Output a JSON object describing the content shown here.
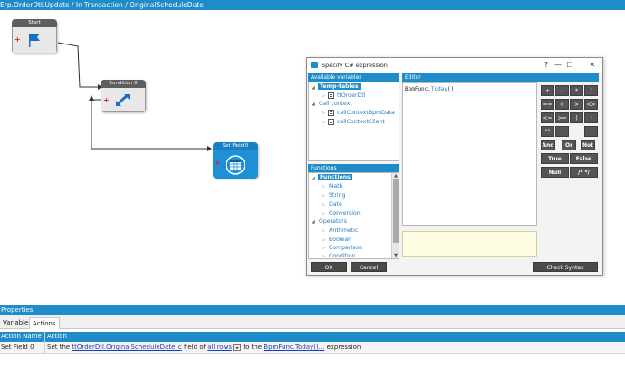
{
  "window": {
    "breadcrumb": "Erp.OrderDtl.Update / In-Transaction / OriginalScheduleDate"
  },
  "workflow": {
    "start_node": {
      "title": "Start"
    },
    "condition_node": {
      "title": "Condition 0"
    },
    "setfield_node": {
      "title": "Set Field 0"
    }
  },
  "dialog": {
    "title": "Specify C# expression",
    "window_controls": {
      "help": "?",
      "minimize": "—",
      "maximize": "☐",
      "close": "✕"
    },
    "variables_header": "Available variables",
    "variables_tree": [
      {
        "label": "Temp-tables",
        "selected": true
      },
      {
        "label": "ttOrderDtl"
      },
      {
        "label": "Call context"
      },
      {
        "label": "callContextBpmData"
      },
      {
        "label": "callContextClient"
      }
    ],
    "functions_header": "Functions",
    "functions_tree": [
      {
        "label": "Functions",
        "selected": true
      },
      {
        "label": "Math"
      },
      {
        "label": "String"
      },
      {
        "label": "Date"
      },
      {
        "label": "Conversion"
      },
      {
        "label": "Operators"
      },
      {
        "label": "Arithmetic"
      },
      {
        "label": "Boolean"
      },
      {
        "label": "Comparison"
      },
      {
        "label": "Condition"
      }
    ],
    "editor_header": "Editor",
    "editor": {
      "obj": "BpmFunc",
      "dot": ".",
      "method": "Today",
      "args": "()"
    },
    "operators": [
      "+",
      "-",
      "*",
      "/",
      "==",
      "<",
      ">",
      "<>",
      "<=",
      ">=",
      "(",
      ")",
      "\"\"",
      ",",
      ":",
      "And",
      "Or",
      "Not",
      "True",
      "False",
      "Null",
      "/* */"
    ],
    "ok_label": "OK",
    "cancel_label": "Cancel",
    "check_syntax_label": "Check Syntax"
  },
  "properties": {
    "header": "Properties",
    "tabs": [
      "Variables",
      "Actions"
    ],
    "active_tab": "Actions",
    "columns": [
      "Action Name",
      "Action"
    ],
    "row": {
      "name": "Set Field 0",
      "pre": "Set the ",
      "field_link": "ttOrderDtl.OriginalScheduleDate_c",
      "mid1": " field of ",
      "rows_link": "all rows",
      "mid2": " to the ",
      "expr_link": "BpmFunc.Today()...",
      "post": " expression"
    }
  }
}
